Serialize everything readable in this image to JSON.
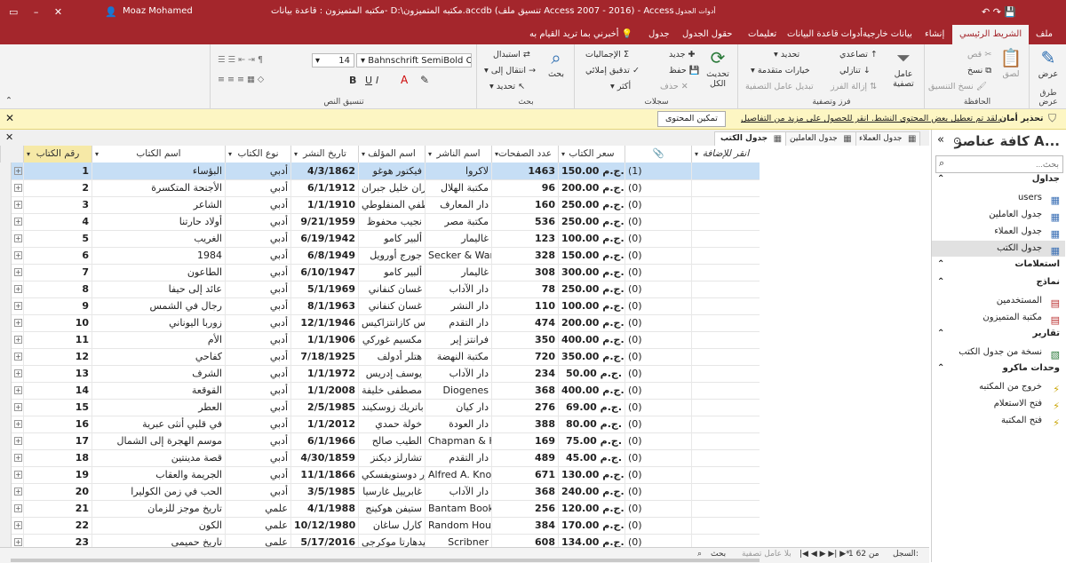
{
  "titlebar": {
    "user": "Moaz Mohamed",
    "title": "مكتبه المتميزون : قاعدة بيانات- D:\\مكتبه المتميزون.accdb (تنسيق ملف Access 2007 - 2016) - Access",
    "context_tab": "أدوات الجدول"
  },
  "ribbon_tabs": {
    "file": "ملف",
    "home": "الشريط الرئيسي",
    "create": "إنشاء",
    "external": "بيانات خارجية",
    "dbtools": "أدوات قاعدة البيانات",
    "help": "تعليمات",
    "fields": "حقول الجدول",
    "table": "جدول",
    "tellme": "أخبرني بما تريد القيام به"
  },
  "ribbon": {
    "view": "عرض",
    "paste": "لصق",
    "cut": "قص",
    "copy": "نسخ",
    "format_painter": "نسخ التنسيق",
    "clipboard": "الحافظة",
    "views": "طرق عرض",
    "filter": "عامل تصفية",
    "ascending": "تصاعدي",
    "descending": "تنازلي",
    "remove_sort": "إزالة الفرز",
    "selection": "تحديد",
    "advanced": "خيارات متقدمة",
    "toggle_filter": "تبديل عامل التصفية",
    "sort_filter": "فرز وتصفية",
    "refresh_all": "تحديث الكل",
    "new": "جديد",
    "save": "حفظ",
    "delete": "حذف",
    "totals": "الإجماليات",
    "spelling": "تدقيق إملائي",
    "more": "أكثر",
    "records": "سجلات",
    "find": "بحث",
    "replace": "استبدال",
    "goto": "انتقال إلى",
    "select": "تحديد",
    "find_group": "بحث",
    "font_name": "Bahnschrift SemiBold Conde",
    "font_size": "14",
    "text_format": "تنسيق النص"
  },
  "msgbar": {
    "title": "تحذير أمان",
    "text": "لقد تم تعطيل بعض المحتوى النشط. انقر للحصول على مزيد من التفاصيل.",
    "button": "تمكين المحتوى"
  },
  "nav": {
    "header": "كافة عناصر A...",
    "search_placeholder": "بحث...",
    "sections": [
      {
        "label": "جداول",
        "items": [
          {
            "label": "users",
            "icon": "table-icon"
          },
          {
            "label": "جدول العاملين",
            "icon": "table-icon"
          },
          {
            "label": "جدول العملاء",
            "icon": "table-icon"
          },
          {
            "label": "جدول الكتب",
            "icon": "table-icon",
            "selected": true
          }
        ]
      },
      {
        "label": "استعلامات",
        "items": []
      },
      {
        "label": "نماذج",
        "items": [
          {
            "label": "المستخدمين",
            "icon": "form-icon"
          },
          {
            "label": "مكتبة المتميزون",
            "icon": "form-icon"
          }
        ]
      },
      {
        "label": "تقارير",
        "items": [
          {
            "label": "نسخة من جدول الكتب",
            "icon": "report-icon"
          }
        ]
      },
      {
        "label": "وحدات ماكرو",
        "items": [
          {
            "label": "خروج من المكتبه",
            "icon": "macro-icon"
          },
          {
            "label": "فتح الاستعلام",
            "icon": "macro-icon"
          },
          {
            "label": "فتح المكتبة",
            "icon": "macro-icon"
          }
        ]
      }
    ]
  },
  "doc_tabs": [
    "جدول العملاء",
    "جدول العاملين",
    "جدول الكتب"
  ],
  "table": {
    "headers": {
      "id": "رقم الكتاب",
      "name": "اسم الكتاب",
      "type": "نوع الكتاب",
      "date": "تاريخ النشر",
      "author": "اسم المؤلف",
      "publisher": "اسم الناشر",
      "pages": "عدد الصفحات",
      "price": "سعر الكتاب",
      "attach": "📎",
      "add": "انقر للإضافة"
    },
    "rows": [
      {
        "id": "1",
        "name": "البؤساء",
        "type": "أدبي",
        "date": "4/3/1862",
        "author": "فيكتور هوغو",
        "publisher": "لاكروا",
        "pages": "1463",
        "price": "150.00 ج.م.",
        "attach": "(1)"
      },
      {
        "id": "2",
        "name": "الأجنحة المتكسرة",
        "type": "أدبي",
        "date": "6/1/1912",
        "author": "جبران خليل جبران",
        "publisher": "مكتبة الهلال",
        "pages": "96",
        "price": "200.00 ج.م.",
        "attach": "(0)"
      },
      {
        "id": "3",
        "name": "الشاعر",
        "type": "أدبي",
        "date": "1/1/1910",
        "author": "مصطفى لطفي المنفلوطي",
        "publisher": "دار المعارف",
        "pages": "160",
        "price": "250.00 ج.م.",
        "attach": "(0)"
      },
      {
        "id": "4",
        "name": "أولاد حارتنا",
        "type": "أدبي",
        "date": "9/21/1959",
        "author": "نجيب محفوظ",
        "publisher": "مكتبة مصر",
        "pages": "536",
        "price": "250.00 ج.م.",
        "attach": "(0)"
      },
      {
        "id": "5",
        "name": "الغريب",
        "type": "أدبي",
        "date": "6/19/1942",
        "author": "ألبير كامو",
        "publisher": "غاليمار",
        "pages": "123",
        "price": "100.00 ج.م.",
        "attach": "(0)"
      },
      {
        "id": "6",
        "name": "1984",
        "type": "أدبي",
        "date": "6/8/1949",
        "author": "جورج أورويل",
        "publisher": "Secker & Warburg",
        "pages": "328",
        "price": "150.00 ج.م.",
        "attach": "(0)"
      },
      {
        "id": "7",
        "name": "الطاعون",
        "type": "أدبي",
        "date": "6/10/1947",
        "author": "ألبير كامو",
        "publisher": "غاليمار",
        "pages": "308",
        "price": "300.00 ج.م.",
        "attach": "(0)"
      },
      {
        "id": "8",
        "name": "عائد إلى حيفا",
        "type": "أدبي",
        "date": "5/1/1969",
        "author": "غسان كنفاني",
        "publisher": "دار الآداب",
        "pages": "78",
        "price": "250.00 ج.م.",
        "attach": "(0)"
      },
      {
        "id": "9",
        "name": "رجال في الشمس",
        "type": "أدبي",
        "date": "8/1/1963",
        "author": "غسان كنفاني",
        "publisher": "دار النشر",
        "pages": "110",
        "price": "100.00 ج.م.",
        "attach": "(0)"
      },
      {
        "id": "10",
        "name": "زوربا اليوناني",
        "type": "أدبي",
        "date": "12/1/1946",
        "author": "نيكوس كازانتزاكيس",
        "publisher": "دار التقدم",
        "pages": "474",
        "price": "200.00 ج.م.",
        "attach": "(0)"
      },
      {
        "id": "11",
        "name": "الأم",
        "type": "أدبي",
        "date": "1/1/1906",
        "author": "مكسيم غوركي",
        "publisher": "فرانتز إير",
        "pages": "350",
        "price": "400.00 ج.م.",
        "attach": "(0)"
      },
      {
        "id": "12",
        "name": "كفاحي",
        "type": "أدبي",
        "date": "7/18/1925",
        "author": "هتلر أدولف",
        "publisher": "مكتبة النهضة",
        "pages": "720",
        "price": "350.00 ج.م.",
        "attach": "(0)"
      },
      {
        "id": "13",
        "name": "الشرف",
        "type": "أدبي",
        "date": "1/1/1972",
        "author": "يوسف إدريس",
        "publisher": "دار الآداب",
        "pages": "234",
        "price": "50.00 ج.م.",
        "attach": "(0)"
      },
      {
        "id": "14",
        "name": "القوقعة",
        "type": "أدبي",
        "date": "1/1/2008",
        "author": "مصطفى خليفة",
        "publisher": "Diogenes",
        "pages": "368",
        "price": "400.00 ج.م.",
        "attach": "(0)"
      },
      {
        "id": "15",
        "name": "العطر",
        "type": "أدبي",
        "date": "2/5/1985",
        "author": "باتريك زوسكيند",
        "publisher": "دار كيان",
        "pages": "276",
        "price": "69.00 ج.م.",
        "attach": "(0)"
      },
      {
        "id": "16",
        "name": "في قلبي أنثى عبرية",
        "type": "أدبي",
        "date": "1/1/2012",
        "author": "خولة حمدي",
        "publisher": "دار العودة",
        "pages": "388",
        "price": "80.00 ج.م.",
        "attach": "(0)"
      },
      {
        "id": "17",
        "name": "موسم الهجرة إلى الشمال",
        "type": "أدبي",
        "date": "6/1/1966",
        "author": "الطيب صالح",
        "publisher": "Chapman & Hall",
        "pages": "169",
        "price": "75.00 ج.م.",
        "attach": "(0)"
      },
      {
        "id": "18",
        "name": "قصة مدينتين",
        "type": "أدبي",
        "date": "4/30/1859",
        "author": "تشارلز ديكنز",
        "publisher": "دار التقدم",
        "pages": "489",
        "price": "45.00 ج.م.",
        "attach": "(0)"
      },
      {
        "id": "19",
        "name": "الجريمة والعقاب",
        "type": "أدبي",
        "date": "11/1/1866",
        "author": "فيودور دوستويفسكي",
        "publisher": "Alfred A. Knopf",
        "pages": "671",
        "price": "130.00 ج.م.",
        "attach": "(0)"
      },
      {
        "id": "20",
        "name": "الحب في زمن الكوليرا",
        "type": "أدبي",
        "date": "3/5/1985",
        "author": "غابرييل غارسيا",
        "publisher": "دار الآداب",
        "pages": "368",
        "price": "240.00 ج.م.",
        "attach": "(0)"
      },
      {
        "id": "21",
        "name": "تاريخ موجز للزمان",
        "type": "علمي",
        "date": "4/1/1988",
        "author": "ستيفن هوكينج",
        "publisher": "Bantam Books",
        "pages": "256",
        "price": "120.00 ج.م.",
        "attach": "(0)"
      },
      {
        "id": "22",
        "name": "الكون",
        "type": "علمي",
        "date": "10/12/1980",
        "author": "كارل ساغان",
        "publisher": "Random House",
        "pages": "384",
        "price": "170.00 ج.م.",
        "attach": "(0)"
      },
      {
        "id": "23",
        "name": "تاريخ حميمي",
        "type": "علمي",
        "date": "5/17/2016",
        "author": "سيدهارتا موكرجي",
        "publisher": "Scribner",
        "pages": "608",
        "price": "134.00 ج.م.",
        "attach": "(0)"
      }
    ]
  },
  "status": {
    "record_label": "السجل:",
    "record_position": "1 من 62",
    "no_filter": "بلا عامل تصفية",
    "search": "بحث"
  },
  "colors": {
    "accent": "#a4262c",
    "selected_row": "#c6def5",
    "key_header": "#f6e9a7"
  }
}
